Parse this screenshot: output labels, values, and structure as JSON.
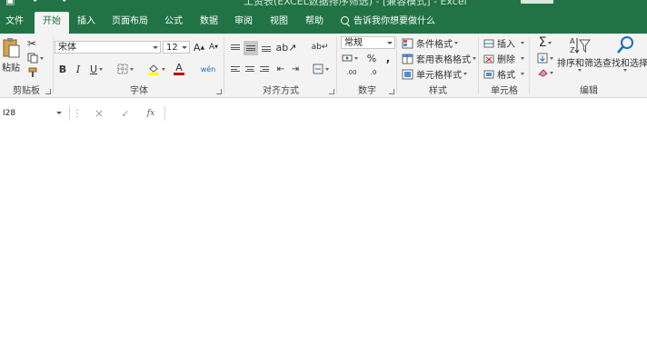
{
  "window": {
    "title": "工资表(EXCEL数据排序筛选) - [兼容模式] - Excel"
  },
  "tabs": [
    {
      "label": "文件"
    },
    {
      "label": "开始",
      "active": true
    },
    {
      "label": "插入"
    },
    {
      "label": "页面布局"
    },
    {
      "label": "公式"
    },
    {
      "label": "数据"
    },
    {
      "label": "审阅"
    },
    {
      "label": "视图"
    },
    {
      "label": "帮助"
    }
  ],
  "tellme": {
    "placeholder": "告诉我你想要做什么"
  },
  "clipboard": {
    "paste_label": "粘贴",
    "group_label": "剪贴板"
  },
  "font": {
    "name": "宋体",
    "size": "12",
    "bold": "B",
    "italic": "I",
    "underline": "U",
    "grow": "A",
    "shrink": "A",
    "color_letter": "A",
    "phonetic": "wén",
    "group_label": "字体",
    "highlight_color": "#ffff00",
    "font_color": "#c00000"
  },
  "alignment": {
    "group_label": "对齐方式"
  },
  "number": {
    "format": "常规",
    "percent": "%",
    "comma": ",",
    "dec_inc": ".00",
    "dec_dec": ".0",
    "group_label": "数字"
  },
  "styles": {
    "conditional": "条件格式",
    "table": "套用表格格式",
    "cell": "单元格样式",
    "group_label": "样式"
  },
  "cells": {
    "insert": "插入",
    "delete": "删除",
    "format": "格式",
    "group_label": "单元格"
  },
  "editing": {
    "sum": "Σ",
    "sort": "排序和筛选",
    "find": "查找和选择",
    "group_label": "编辑"
  },
  "formula_bar": {
    "name_box": "I28",
    "fx": "fx",
    "cancel": "×",
    "enter": "✓",
    "value": ""
  },
  "colors": {
    "accent": "#217346",
    "ribbon_bg": "#f3f3f3"
  }
}
